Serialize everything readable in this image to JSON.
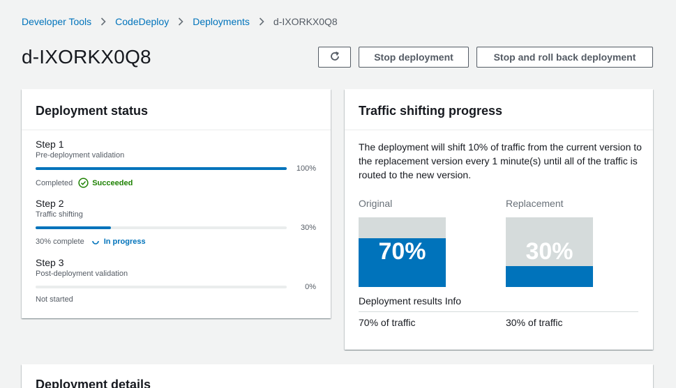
{
  "breadcrumb": {
    "items": [
      "Developer Tools",
      "CodeDeploy",
      "Deployments"
    ],
    "current": "d-IXORKX0Q8"
  },
  "page": {
    "title": "d-IXORKX0Q8"
  },
  "toolbar": {
    "refresh_icon": "refresh-icon",
    "stop_label": "Stop deployment",
    "rollback_label": "Stop and roll back deployment"
  },
  "status": {
    "title": "Deployment status",
    "steps": [
      {
        "title": "Step 1",
        "subtitle": "Pre-deployment validation",
        "percent": 100,
        "percent_label": "100%",
        "state_label": "Completed",
        "result": "Succeeded"
      },
      {
        "title": "Step 2",
        "subtitle": "Traffic shifting",
        "percent": 30,
        "percent_label": "30%",
        "state_label": "30% complete",
        "result": "In progress"
      },
      {
        "title": "Step 3",
        "subtitle": "Post-deployment validation",
        "percent": 0,
        "percent_label": "0%",
        "state_label": "Not started",
        "result": ""
      }
    ]
  },
  "traffic": {
    "title": "Traffic shifting progress",
    "description": "The deployment will shift 10% of traffic from the current version to the replacement version every 1 minute(s) until all of the traffic is routed to the new version.",
    "original": {
      "label": "Original",
      "percent": 70,
      "percent_label": "70%",
      "traffic_label": "70% of traffic"
    },
    "replacement": {
      "label": "Replacement",
      "percent": 30,
      "percent_label": "30%",
      "traffic_label": "30% of traffic"
    },
    "results_label": "Deployment results Info"
  },
  "details": {
    "title": "Deployment details"
  },
  "colors": {
    "accent": "#0073bb",
    "success": "#1d8102",
    "track": "#eaeded"
  }
}
